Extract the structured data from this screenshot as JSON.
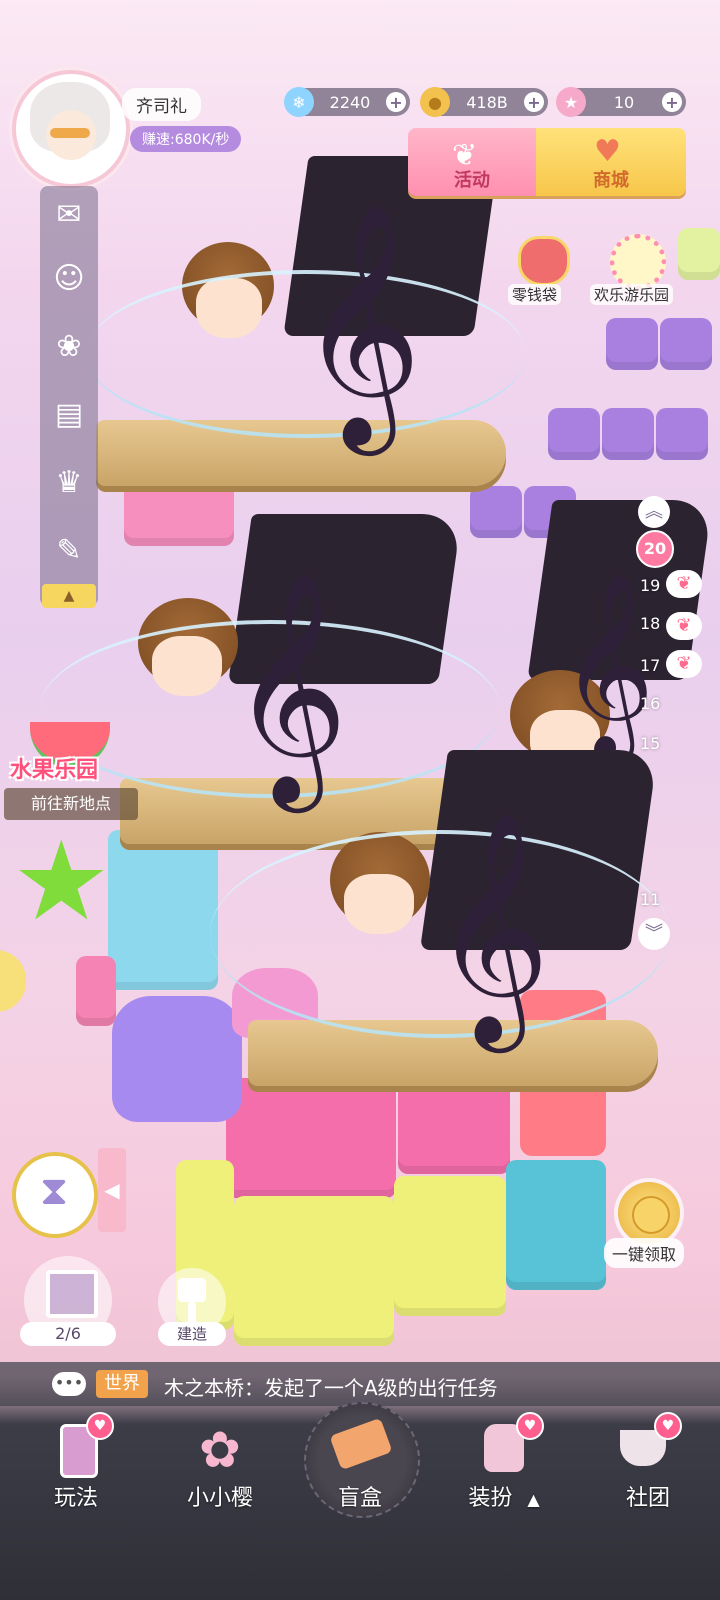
{
  "profile": {
    "name": "齐司礼",
    "speed": "赚速:680K/秒"
  },
  "currencies": [
    {
      "icon": "snowflake-icon",
      "value": "2240"
    },
    {
      "icon": "coin-icon",
      "value": "418B"
    },
    {
      "icon": "star-icon",
      "value": "10"
    }
  ],
  "banner": {
    "activity": "活动",
    "shop": "商城"
  },
  "shortcuts": {
    "wallet": "零钱袋",
    "amusement_park": "欢乐游乐园"
  },
  "side_menu": {
    "items": [
      {
        "name": "mail-icon"
      },
      {
        "name": "friends-icon"
      },
      {
        "name": "pet-icon"
      },
      {
        "name": "notice-icon"
      },
      {
        "name": "trophy-icon"
      },
      {
        "name": "chat-icon"
      }
    ],
    "toggle": "▲"
  },
  "floors": {
    "current": "20",
    "labels": [
      "19",
      "18",
      "17",
      "16",
      "15",
      "11"
    ]
  },
  "fruit_park": {
    "title": "水果乐园",
    "go_label": "前往新地点"
  },
  "claim": {
    "label": "一键领取"
  },
  "gift": {
    "count": "2/6"
  },
  "build": {
    "label": "建造"
  },
  "chat": {
    "channel": "世界",
    "message": "木之本桥：发起了一个A级的出行任务"
  },
  "nav": [
    {
      "label": "玩法",
      "badge": true
    },
    {
      "label": "小小樱",
      "badge": false
    },
    {
      "label": "盲盒",
      "badge": false
    },
    {
      "label": "装扮",
      "badge": true,
      "arrow": "▲"
    },
    {
      "label": "社团",
      "badge": true
    }
  ]
}
